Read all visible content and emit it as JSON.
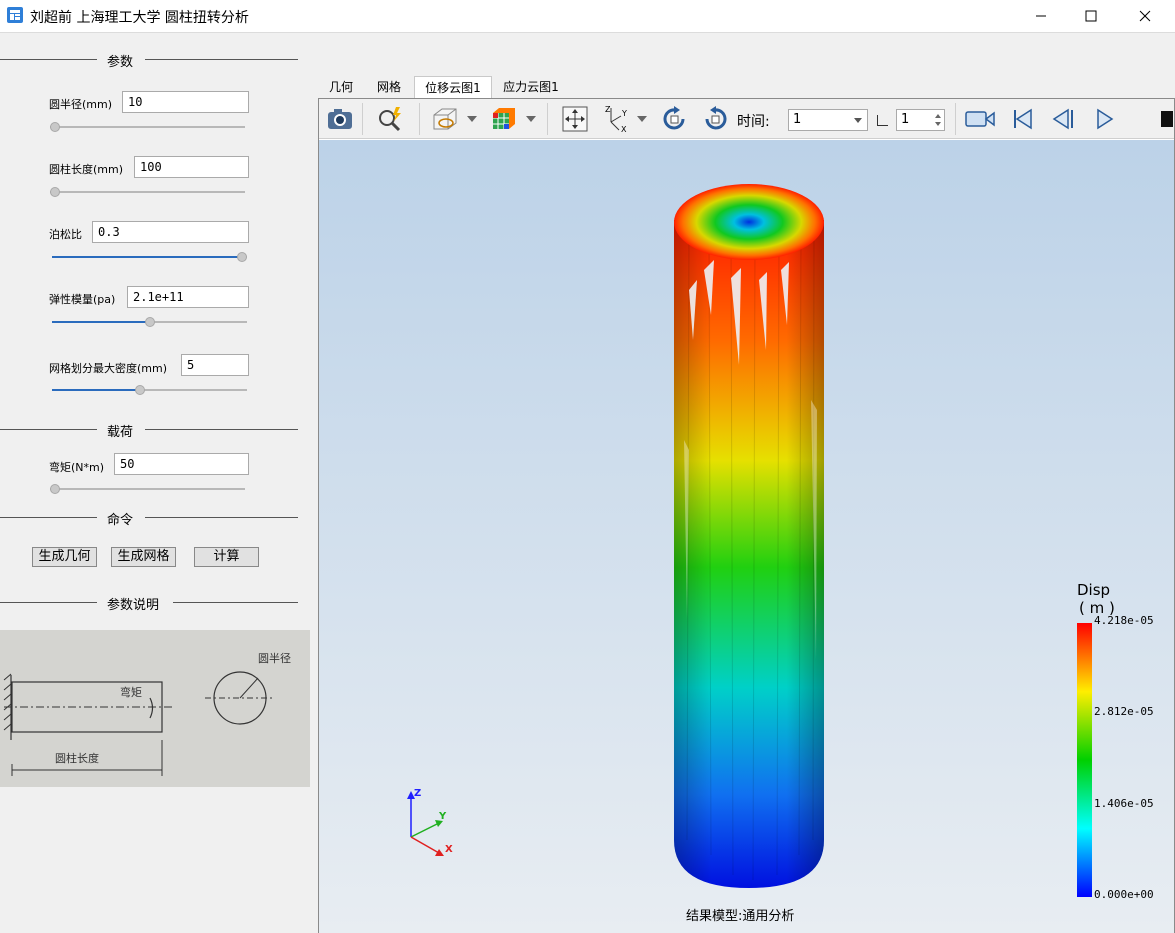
{
  "window": {
    "title": "刘超前 上海理工大学 圆柱扭转分析",
    "icon": "app-icon",
    "buttons": [
      "minimize-icon",
      "maximize-icon",
      "close-icon"
    ]
  },
  "sections": {
    "params": "参数",
    "load": "载荷",
    "command": "命令",
    "description": "参数说明"
  },
  "params": [
    {
      "label": "圆半径(mm)",
      "value": "10",
      "slider": 0.0
    },
    {
      "label": "圆柱长度(mm)",
      "value": "100",
      "slider": 0.0
    },
    {
      "label": "泊松比",
      "value": "0.3",
      "slider": 1.0
    },
    {
      "label": "弹性模量(pa)",
      "value": "2.1e+11",
      "slider": 0.5
    },
    {
      "label": "网格划分最大密度(mm)",
      "value": "5",
      "slider": 0.45
    }
  ],
  "load": {
    "label": "弯矩(N*m)",
    "value": "50",
    "slider": 0.0
  },
  "commands": [
    "生成几何",
    "生成网格",
    "计算"
  ],
  "sketch": {
    "labels": [
      "弯矩",
      "圆半径",
      "圆柱长度"
    ]
  },
  "tabs": [
    {
      "label": "几何",
      "active": false
    },
    {
      "label": "网格",
      "active": false
    },
    {
      "label": "位移云图1",
      "active": true
    },
    {
      "label": "应力云图1",
      "active": false
    }
  ],
  "toolbar": {
    "icons": [
      "camera-icon",
      "zoom-select-icon",
      "display-mode-icon",
      "color-cube-icon",
      "fit-view-icon",
      "axes-icon",
      "rotate-cw-icon",
      "rotate-ccw-icon",
      "record-icon",
      "first-frame-icon",
      "prev-frame-icon",
      "play-icon"
    ],
    "time_label": "时间:",
    "time_value": "1",
    "step_value": "1"
  },
  "viewer": {
    "result_label": "结果模型:通用分析",
    "axes": {
      "x": "X",
      "y": "Y",
      "z": "Z"
    }
  },
  "legend": {
    "title": "Disp",
    "unit": "( m )",
    "ticks": [
      "4.218e-05",
      "2.812e-05",
      "1.406e-05",
      "0.000e+00"
    ],
    "colors": [
      "#ff0000",
      "#ffee00",
      "#00d000",
      "#00ffff",
      "#0000ff"
    ]
  }
}
